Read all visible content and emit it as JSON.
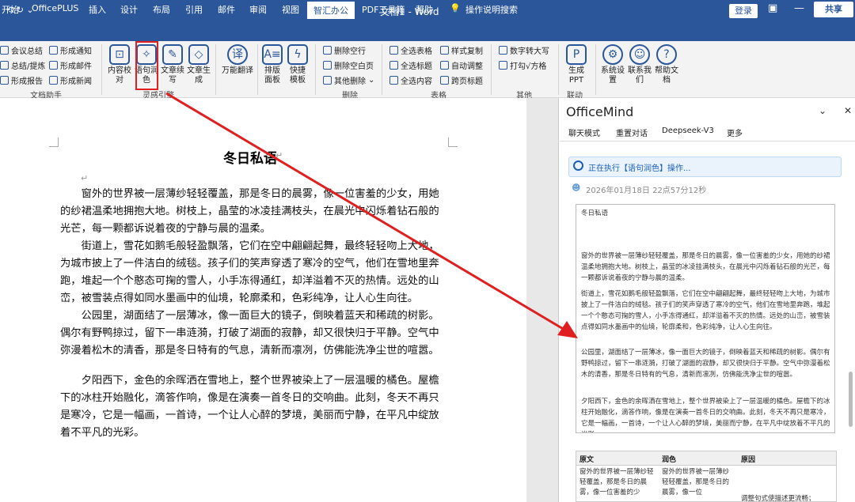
{
  "window": {
    "title": "文档1 - Word",
    "login": "登录",
    "minimize": "—",
    "restore": "❐",
    "close": "✕"
  },
  "tabs": [
    "开始",
    "OfficePLUS",
    "插入",
    "设计",
    "布局",
    "引用",
    "邮件",
    "审阅",
    "视图",
    "智汇办公",
    "PDF工具箱",
    "帮助",
    "操作说明搜索"
  ],
  "share": "共享",
  "ribbon": {
    "doc_helper": {
      "items": [
        "会议总结",
        "总结/提炼",
        "形成报告",
        "形成通知",
        "形成邮件",
        "形成新闻"
      ],
      "label": "文档助手"
    },
    "inspire": {
      "items": [
        "内容校对",
        "语句润色",
        "文章续写",
        "文章生成"
      ],
      "label": "灵感引擎"
    },
    "translate": {
      "item": "万能翻译"
    },
    "typeset": {
      "items": [
        "排版面板",
        "快捷模板"
      ]
    },
    "delete": {
      "items": [
        "删除空行",
        "删除空白页",
        "其他删除"
      ],
      "label": "删除"
    },
    "table": {
      "items": [
        "全选表格",
        "全选标题",
        "全选内容",
        "样式复制",
        "自动调整",
        "跨页标题"
      ],
      "label": "表格"
    },
    "other": {
      "items": [
        "数字转大写",
        "打勾√方格"
      ],
      "label": "其他"
    },
    "link": {
      "items": [
        "生成PPT"
      ],
      "label": "联动"
    },
    "system": {
      "items": [
        "系统设置",
        "联系我们",
        "帮助文档"
      ]
    }
  },
  "document": {
    "title": "冬日私语",
    "paragraphs": [
      "窗外的世界被一层薄纱轻轻覆盖，那是冬日的晨雾，像一位害羞的少女，用她的纱裙温柔地拥抱大地。树枝上，晶莹的冰凌挂满枝头，在晨光中闪烁着钻石般的光芒，每一颗都诉说着夜的宁静与晨的温柔。",
      "街道上，雪花如鹅毛般轻盈飘落，它们在空中翩翩起舞，最终轻轻吻上大地，为城市披上了一件洁白的绒毯。孩子们的笑声穿透了寒冷的空气，他们在雪地里奔跑，堆起一个个憨态可掬的雪人，小手冻得通红，却洋溢着不灭的热情。远处的山峦，被雪装点得如同水墨画中的仙境，轮廓柔和，色彩纯净，让人心生向往。",
      "公园里，湖面结了一层薄冰，像一面巨大的镜子，倒映着蓝天和稀疏的树影。偶尔有野鸭掠过，留下一串涟漪，打破了湖面的寂静，却又很快归于平静。空气中弥漫着松木的清香，那是冬日特有的气息，清新而凛冽，仿佛能洗净尘世的喧嚣。",
      "夕阳西下，金色的余晖洒在雪地上，整个世界被染上了一层温暖的橘色。屋檐下的冰柱开始融化，滴答作响，像是在演奏一首冬日的交响曲。此刻，冬天不再只是寒冷，它是一幅画，一首诗，一个让人心醉的梦境，美丽而宁静，在平凡中绽放着不平凡的光彩。"
    ]
  },
  "pane": {
    "title": "OfficeMind",
    "menu": [
      "聊天模式",
      "重置对话",
      "Deepseek-V3",
      "更多"
    ],
    "status": "正在执行【语句润色】操作...",
    "timestamp": "2026年01月18日 22点57分12秒",
    "result_title": "冬日私语",
    "result_paragraphs": [
      "窗外的世界被一层薄纱轻轻覆盖，那是冬日的晨雾，像一位害羞的少女，用她的纱裙温柔地拥抱大地。树枝上，晶莹的冰凌挂满枝头，在晨光中闪烁着钻石般的光芒，每一颗都诉说着夜的宁静与晨的温柔。",
      "街道上，雪花如鹅毛般轻盈飘落，它们在空中翩翩起舞，最终轻轻吻上大地，为城市披上了一件洁白的绒毯。孩子们的笑声穿透了寒冷的空气，他们在雪地里奔跑，堆起一个个憨态可掬的雪人，小手冻得通红，却洋溢着不灭的热情。远处的山峦，被雪装点得如同水墨画中的仙境，轮廓柔和，色彩纯净，让人心生向往。",
      "公园里，湖面结了一层薄冰，像一面巨大的镜子，倒映着蓝天和稀疏的树影。偶尔有野鸭掠过，留下一串涟漪，打破了湖面的寂静，却又很快归于平静。空气中弥漫着松木的清香，那是冬日特有的气息，清新而凛冽，仿佛能洗净尘世的喧嚣。",
      "夕阳西下，金色的余晖洒在雪地上，整个世界被染上了一层温暖的橘色。屋檐下的冰柱开始融化，滴答作响，像是在演奏一首冬日的交响曲。此刻，冬天不再只是寒冷，它是一幅画，一首诗，一个让人心醉的梦境，美丽而宁静，在平凡中绽放着不平凡的光彩。"
    ],
    "table": {
      "headers": [
        "原文",
        "润色",
        "原因"
      ],
      "row": [
        "窗外的世界被一层薄纱轻轻覆盖，那是冬日的晨雾，像一位害羞的少",
        "窗外的世界被一层薄纱轻轻覆盖，那是冬日的晨雾，像一位",
        "调整句式使描述更流畅；"
      ]
    }
  },
  "colors": {
    "brand": "#2b579a",
    "highlight": "#e02020",
    "deleted": "#d22222",
    "inserted": "#1a9e1a"
  }
}
